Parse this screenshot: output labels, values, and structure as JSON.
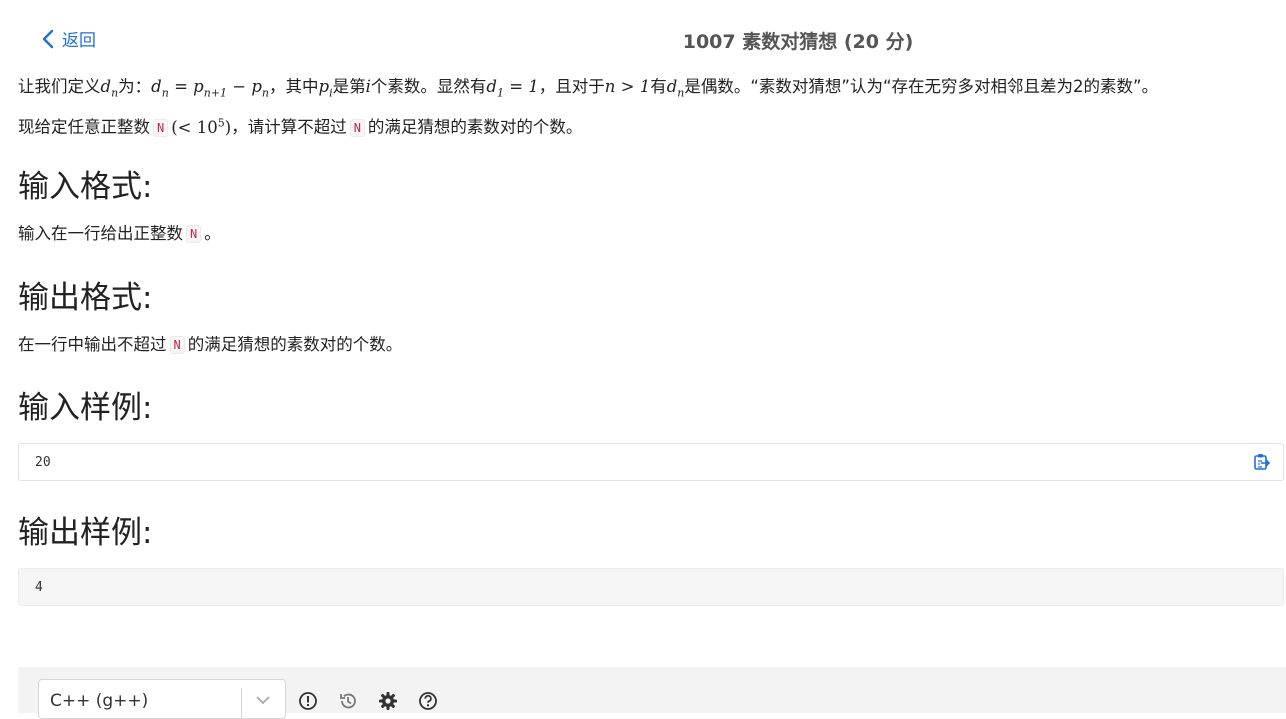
{
  "header": {
    "back_label": "返回",
    "title": "1007 素数对猜想 (20 分)"
  },
  "statement": {
    "p1_a": "让我们定义",
    "p1_b": "为：",
    "p1_c": "，其中",
    "p1_d": "是第",
    "p1_e": "个素数。显然有",
    "p1_f": "，且对于",
    "p1_g": "有",
    "p1_h": "是偶数。“素数对猜想”认为“存在无穷多对相邻且差为2的素数”。",
    "p2_a": "现给定任意正整数",
    "p2_b": "，请计算不超过",
    "p2_c": "的满足猜想的素数对的个数。",
    "var_n": "N"
  },
  "sections": {
    "input_format_heading": "输入格式:",
    "input_format_a": "输入在一行给出正整数",
    "input_format_b": "。",
    "output_format_heading": "输出格式:",
    "output_format_a": "在一行中输出不超过",
    "output_format_b": "的满足猜想的素数对的个数。",
    "sample_input_heading": "输入样例:",
    "sample_input": "20",
    "sample_output_heading": "输出样例:",
    "sample_output": "4"
  },
  "editor": {
    "language": "C++ (g++)"
  },
  "icons": {
    "back": "chevron-left-icon",
    "copy": "clipboard-copy-icon",
    "info": "exclamation-circle-icon",
    "history": "history-icon",
    "settings": "gear-icon",
    "help": "question-circle-icon"
  },
  "colors": {
    "link": "#1e6fd9",
    "inline_code": "#c7254e",
    "editor_bar": "#f3f3f3"
  }
}
